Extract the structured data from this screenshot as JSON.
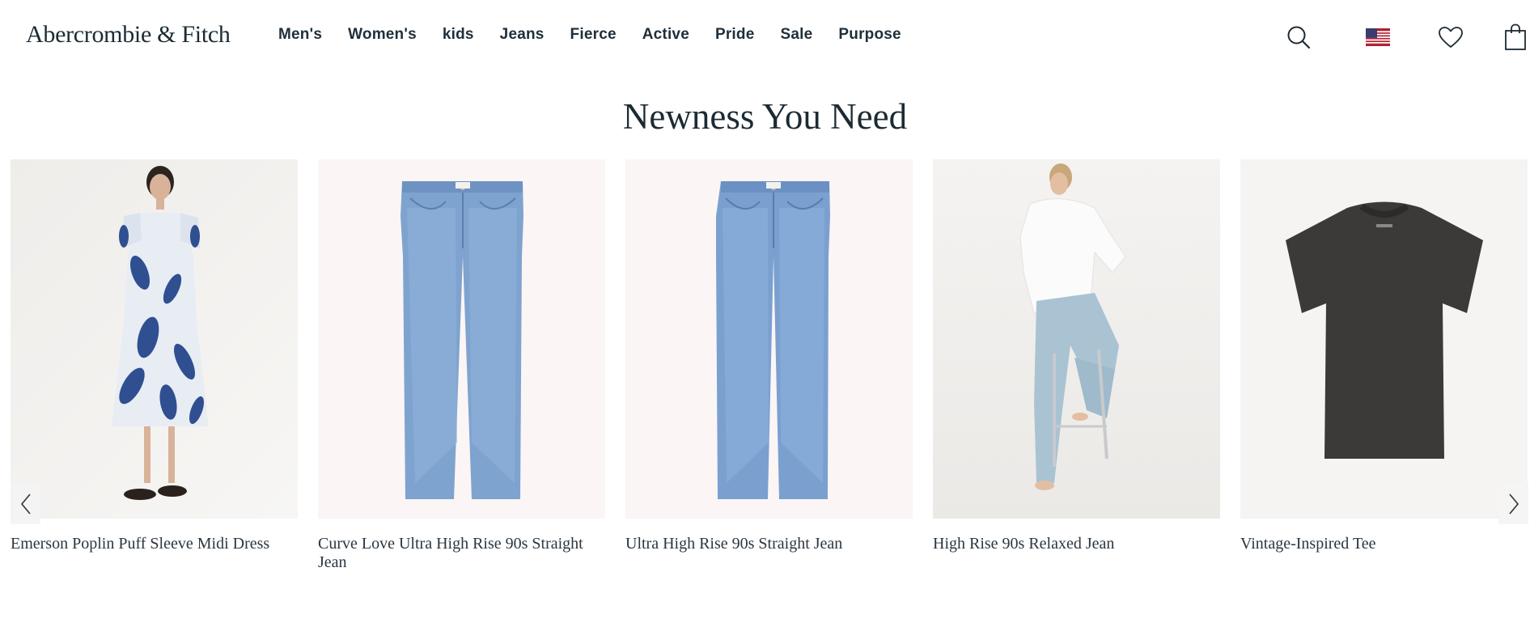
{
  "brand": {
    "logo": "Abercrombie & Fitch"
  },
  "nav": {
    "items": [
      "Men's",
      "Women's",
      "kids",
      "Jeans",
      "Fierce",
      "Active",
      "Pride",
      "Sale",
      "Purpose"
    ]
  },
  "utility": {
    "icons": [
      "search-icon",
      "us-flag-icon",
      "heart-icon",
      "shopping-bag-icon"
    ]
  },
  "section": {
    "title": "Newness You Need"
  },
  "products": [
    {
      "name": "Emerson Poplin Puff Sleeve Midi Dress"
    },
    {
      "name": "Curve Love Ultra High Rise 90s Straight Jean"
    },
    {
      "name": "Ultra High Rise 90s Straight Jean"
    },
    {
      "name": "High Rise 90s Relaxed Jean"
    },
    {
      "name": "Vintage-Inspired Tee"
    }
  ],
  "colors": {
    "text": "#1c2b33",
    "denim": "#7fa3cf",
    "tee": "#3b3a38"
  }
}
